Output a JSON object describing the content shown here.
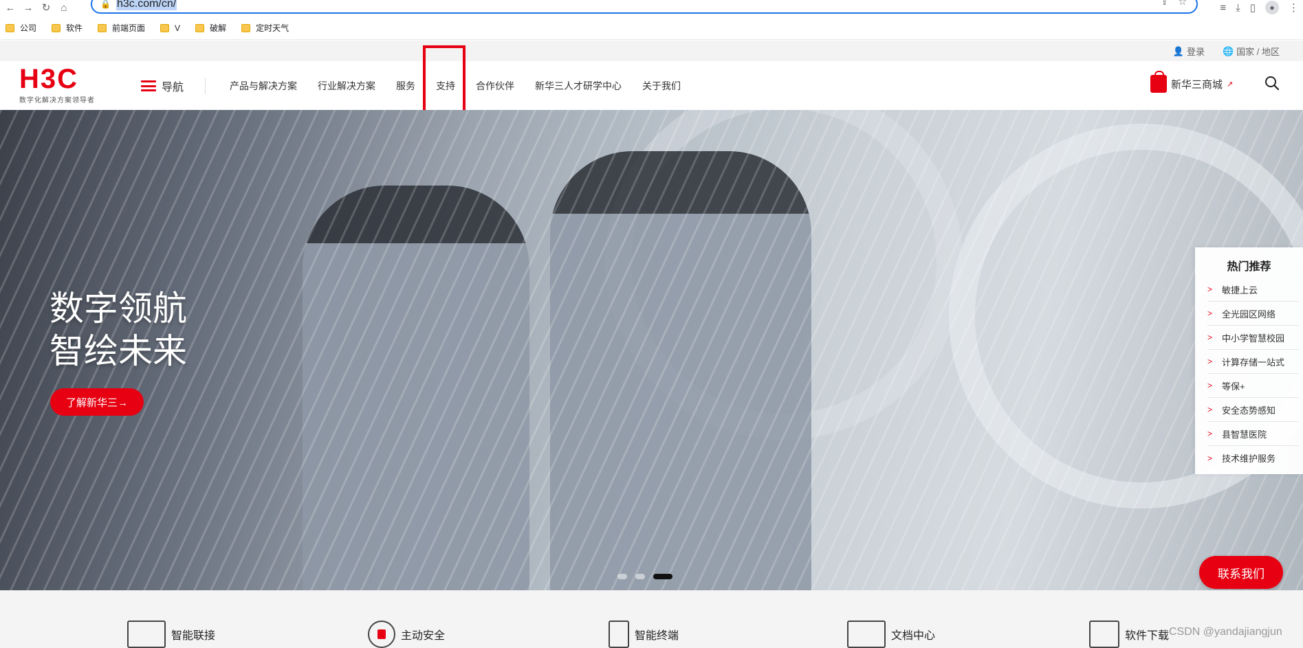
{
  "browser": {
    "url": "h3c.com/cn/",
    "back_icon": "back-arrow-icon",
    "forward_icon": "forward-arrow-icon"
  },
  "bookmarks": [
    {
      "label": "公司"
    },
    {
      "label": "软件"
    },
    {
      "label": "前端页面"
    },
    {
      "label": "V"
    },
    {
      "label": "破解"
    },
    {
      "label": "定时天气"
    }
  ],
  "topbar": {
    "login": "登录",
    "region": "国家 / 地区"
  },
  "header": {
    "logo_text": "H3C",
    "logo_tagline": "数字化解决方案领导者",
    "menu_label": "导航",
    "nav": [
      "产品与解决方案",
      "行业解决方案",
      "服务",
      "支持",
      "合作伙伴",
      "新华三人才研学中心",
      "关于我们"
    ],
    "mall_label": "新华三商城",
    "accent_color": "#e60012"
  },
  "hero": {
    "headline_line1": "数字领航",
    "headline_line2": "智绘未来",
    "cta_label": "了解新华三→",
    "slides_total": 3,
    "active_slide": 3
  },
  "hot": {
    "title": "热门推荐",
    "items": [
      "敏捷上云",
      "全光园区网络",
      "中小学智慧校园",
      "计算存储一站式",
      "等保+",
      "安全态势感知",
      "县智慧医院",
      "技术维护服务"
    ]
  },
  "contact_label": "联系我们",
  "features": [
    "智能联接",
    "主动安全",
    "智能终端",
    "文档中心",
    "软件下载"
  ],
  "watermark": "CSDN @yandajiangjun"
}
